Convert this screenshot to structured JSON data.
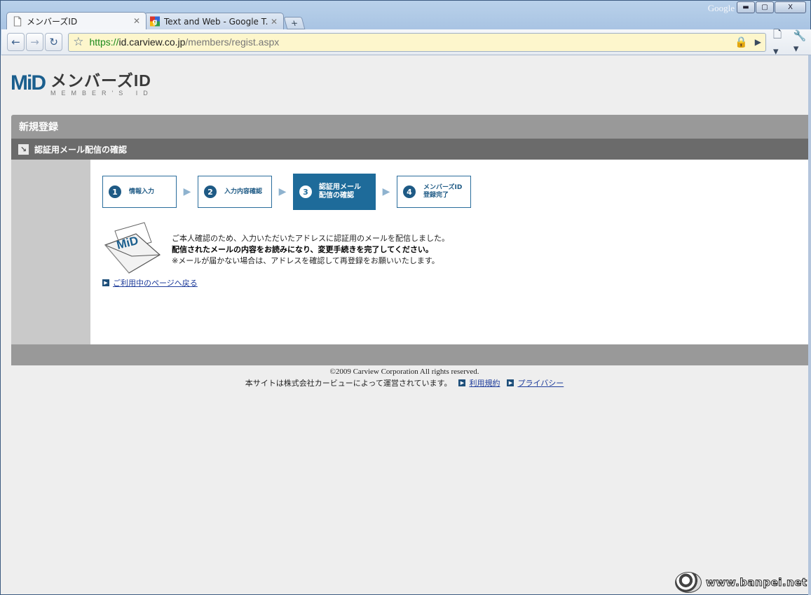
{
  "browser": {
    "brand_label": "Google",
    "window_controls": {
      "minimize": "▬",
      "maximize": "▢",
      "close": "X"
    },
    "tabs": [
      {
        "title": "メンバーズID",
        "active": true,
        "icon": "page-icon"
      },
      {
        "title": "Text and Web - Google T...",
        "active": false,
        "icon": "google-icon"
      }
    ],
    "new_tab": "+",
    "address": {
      "scheme": "https://",
      "host": "id.carview.co.jp",
      "path": "/members/regist.aspx"
    }
  },
  "logo": {
    "mark": "MiD",
    "main": "メンバーズID",
    "sub": "MEMBER'S ID"
  },
  "page": {
    "section_title": "新規登録",
    "sub_title": "認証用メール配信の確認",
    "steps": [
      {
        "num": "1",
        "label": "情報入力",
        "active": false
      },
      {
        "num": "2",
        "label": "入力内容確認",
        "active": false
      },
      {
        "num": "3",
        "label": "認証用メール\n配信の確認",
        "active": true
      },
      {
        "num": "4",
        "label": "メンバーズID\n登録完了",
        "active": false
      }
    ],
    "envelope_mark": "MiD",
    "message": {
      "line1": "ご本人確認のため、入力いただいたアドレスに認証用のメールを配信しました。",
      "line2": "配信されたメールの内容をお読みになり、変更手続きを完了してください。",
      "line3": "※メールが届かない場合は、アドレスを確認して再登録をお願いいたします。"
    },
    "back_link": "ご利用中のページへ戻る"
  },
  "footer": {
    "copyright": "©2009 Carview Corporation All rights reserved.",
    "operated_by": "本サイトは株式会社カービューによって運営されています。",
    "terms_link": "利用規約",
    "privacy_link": "プライバシー"
  },
  "watermark": {
    "text": "www.banpei.net"
  },
  "colors": {
    "accent": "#1e6b9a",
    "section_bar": "#999999",
    "sub_bar": "#6b6b6b",
    "link": "#1f3d9b",
    "omnibox_bg": "#fdf6cc"
  }
}
